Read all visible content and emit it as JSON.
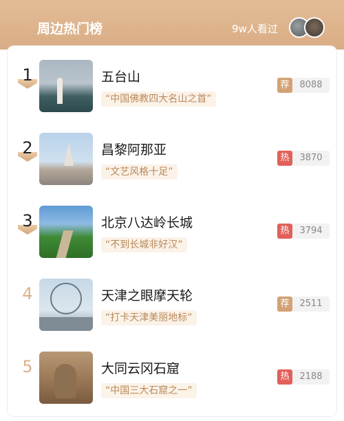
{
  "header": {
    "title": "周边热门榜",
    "views": "9w人看过",
    "avatar_count": 2
  },
  "colors": {
    "header_bg": "#deb48d",
    "badge_recommend": "#d2a275",
    "badge_hot": "#e1605a",
    "tag_text": "#b98a5b",
    "rank_muted": "#d8b38a"
  },
  "items": [
    {
      "rank": "1",
      "name": "五台山",
      "tag": "“中国佛教四大名山之首”",
      "badge": "荐",
      "badge_type": "recommend",
      "count": "8088",
      "thumbnail": "pagoda-mountain-image"
    },
    {
      "rank": "2",
      "name": "昌黎阿那亚",
      "tag": "“文艺风格十足”",
      "badge": "热",
      "badge_type": "hot",
      "count": "3870",
      "thumbnail": "seaside-chapel-image"
    },
    {
      "rank": "3",
      "name": "北京八达岭长城",
      "tag": "“不到长城非好汉”",
      "badge": "热",
      "badge_type": "hot",
      "count": "3794",
      "thumbnail": "great-wall-image"
    },
    {
      "rank": "4",
      "name": "天津之眼摩天轮",
      "tag": "“打卡天津美丽地标”",
      "badge": "荐",
      "badge_type": "recommend",
      "count": "2511",
      "thumbnail": "ferris-wheel-image"
    },
    {
      "rank": "5",
      "name": "大同云冈石窟",
      "tag": "“中国三大石窟之一”",
      "badge": "热",
      "badge_type": "hot",
      "count": "2188",
      "thumbnail": "buddha-grotto-image"
    }
  ]
}
